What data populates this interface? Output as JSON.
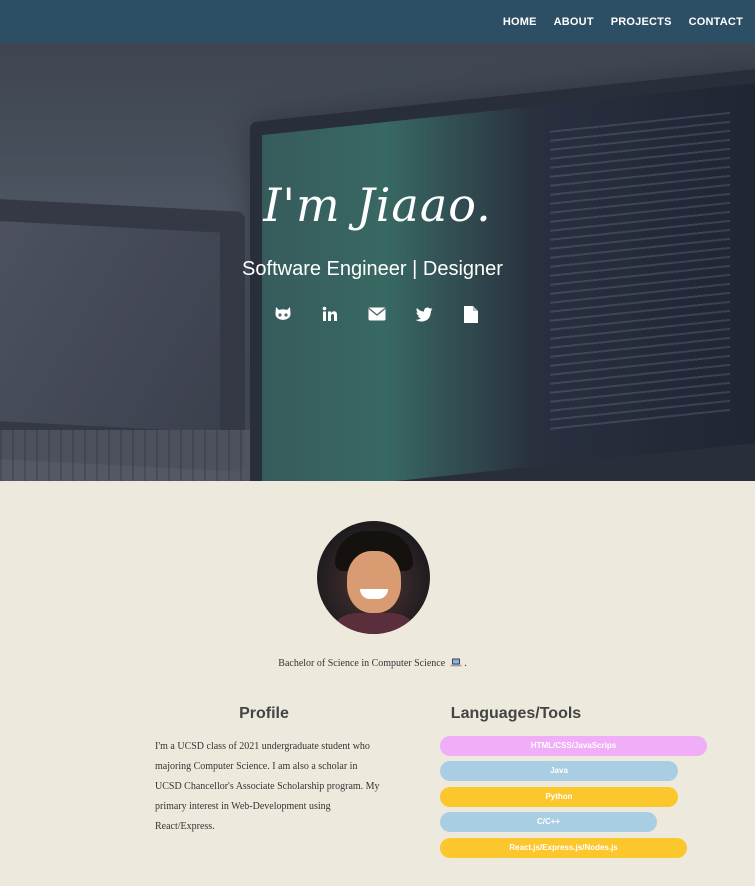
{
  "nav": {
    "items": [
      {
        "label": "HOME"
      },
      {
        "label": "ABOUT"
      },
      {
        "label": "PROJECTS"
      },
      {
        "label": "CONTACT"
      }
    ]
  },
  "hero": {
    "title": "I'm Jiaao.",
    "subtitle": "Software Engineer | Designer",
    "social_icons": [
      "github-icon",
      "linkedin-icon",
      "envelope-icon",
      "twitter-icon",
      "file-icon"
    ]
  },
  "about": {
    "degree": "Bachelor of Science in Computer Science",
    "degree_suffix": ".",
    "profile_heading": "Profile",
    "profile_text": "I'm a UCSD class of 2021 undergraduate student who majoring Computer Science. I am also a scholar in UCSD Chancellor's Associate Scholarship program. My primary interest in Web-Development using React/Express.",
    "tools_heading": "Languages/Tools",
    "tools": [
      {
        "label": "HTML/CSS/JavaScrips",
        "level": 0.9,
        "color": "#efaef7"
      },
      {
        "label": "Java",
        "level": 0.8,
        "color": "#a9cee3"
      },
      {
        "label": "Python",
        "level": 0.8,
        "color": "#fcc62d"
      },
      {
        "label": "C/C++",
        "level": 0.73,
        "color": "#a9cee3"
      },
      {
        "label": "React.js/Express.js/Nodes.js",
        "level": 0.83,
        "color": "#fcc62d"
      }
    ]
  },
  "colors": {
    "navbar": "#2c4f66",
    "background": "#edeadd"
  }
}
